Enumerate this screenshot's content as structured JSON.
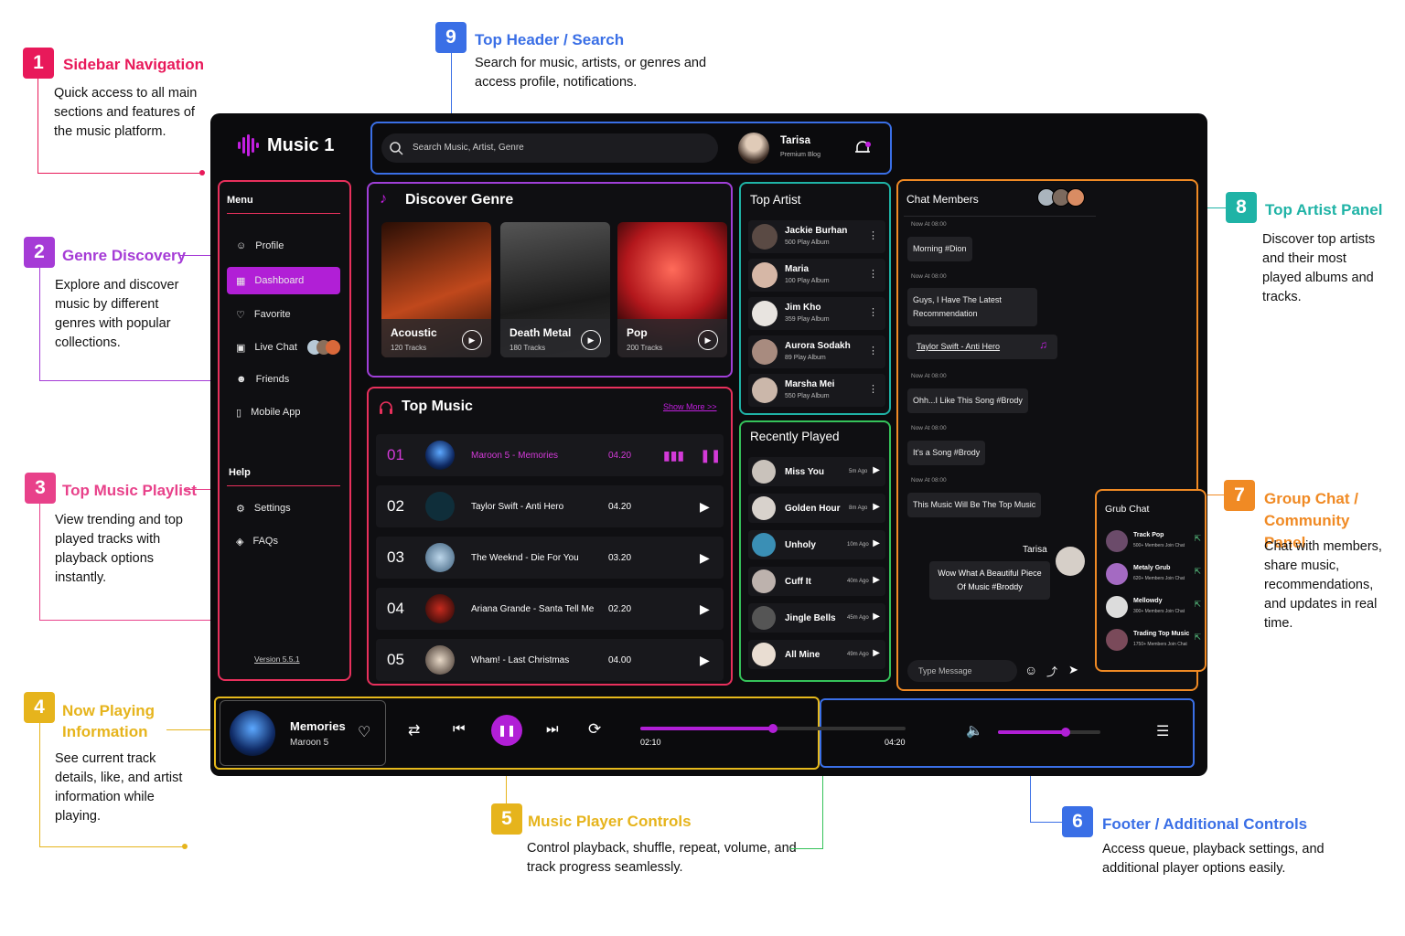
{
  "app": {
    "logo": "Music 1",
    "search_placeholder": "Search Music, Artist, Genre",
    "user_name": "Tarisa",
    "user_sub": "Premium Blog",
    "version": "Version 5.5.1"
  },
  "colors": {
    "accent": "#b11fd6",
    "sidebar_border": "#e8305c",
    "genre_border": "#a03fd8",
    "topmusic_border": "#e8305c",
    "topartist_border": "#1fb3a6",
    "recent_border": "#35c25a",
    "chat_border": "#f08a24",
    "header_border": "#3a6fe6",
    "player_border": "#e6b91c"
  },
  "sidebar": {
    "menu_label": "Menu",
    "items": [
      {
        "label": "Profile",
        "icon": "user-icon"
      },
      {
        "label": "Dashboard",
        "icon": "grid-icon",
        "active": true
      },
      {
        "label": "Favorite",
        "icon": "heart-icon"
      },
      {
        "label": "Live Chat",
        "icon": "chat-icon"
      },
      {
        "label": "Friends",
        "icon": "friends-icon"
      },
      {
        "label": "Mobile App",
        "icon": "phone-icon"
      }
    ],
    "help_label": "Help",
    "help_items": [
      {
        "label": "Settings",
        "icon": "gear-icon"
      },
      {
        "label": "FAQs",
        "icon": "help-icon"
      }
    ]
  },
  "genre": {
    "title": "Discover Genre",
    "items": [
      {
        "name": "Acoustic",
        "tracks": "120 Tracks"
      },
      {
        "name": "Death Metal",
        "tracks": "180 Tracks"
      },
      {
        "name": "Pop",
        "tracks": "200 Tracks"
      }
    ]
  },
  "top_music": {
    "title": "Top Music",
    "show_more": "Show More >>",
    "tracks": [
      {
        "num": "01",
        "name": "Maroon 5 - Memories",
        "time": "04.20"
      },
      {
        "num": "02",
        "name": "Taylor Swift - Anti Hero",
        "time": "04.20"
      },
      {
        "num": "03",
        "name": "The Weeknd - Die For You",
        "time": "03.20"
      },
      {
        "num": "04",
        "name": "Ariana Grande - Santa Tell Me",
        "time": "02.20"
      },
      {
        "num": "05",
        "name": "Wham! - Last Christmas",
        "time": "04.00"
      }
    ]
  },
  "top_artist": {
    "title": "Top Artist",
    "artists": [
      {
        "name": "Jackie Burhan",
        "albums": "500 Play Album"
      },
      {
        "name": "Maria",
        "albums": "100 Play Album"
      },
      {
        "name": "Jim Kho",
        "albums": "359 Play Album"
      },
      {
        "name": "Aurora Sodakh",
        "albums": "89 Play Album"
      },
      {
        "name": "Marsha Mei",
        "albums": "550 Play Album"
      }
    ]
  },
  "recent": {
    "title": "Recently Played",
    "items": [
      {
        "name": "Miss You",
        "ago": "5m Ago"
      },
      {
        "name": "Golden Hour",
        "ago": "8m Ago"
      },
      {
        "name": "Unholy",
        "ago": "10m Ago"
      },
      {
        "name": "Cuff It",
        "ago": "40m Ago"
      },
      {
        "name": "Jingle Bells",
        "ago": "45m Ago"
      },
      {
        "name": "All Mine",
        "ago": "49m Ago"
      }
    ]
  },
  "chat": {
    "title": "Chat Members",
    "stamp": "Now At 08:00",
    "messages": [
      "Morning #Dion",
      "Guys, I Have The Latest Recommendation",
      "Taylor Swift - Anti Hero",
      "Ohh...I Like This Song #Brody",
      "It's a Song #Brody",
      "This Music Will Be The Top Music"
    ],
    "reply_name": "Tarisa",
    "reply_text": "Wow What A Beautiful Piece Of Music #Broddy",
    "input_placeholder": "Type Message"
  },
  "group_chat": {
    "title": "Grub Chat",
    "groups": [
      {
        "name": "Track Pop",
        "members": "500+ Members Join Chat"
      },
      {
        "name": "Metaly Grub",
        "members": "620+ Members Join Chat"
      },
      {
        "name": "Mellowdy",
        "members": "300+ Members Join Chat"
      },
      {
        "name": "Trading Top Music",
        "members": "1750+ Members Join Chat"
      }
    ]
  },
  "player": {
    "title": "Memories",
    "artist": "Maroon 5",
    "elapsed": "02:10",
    "total": "04:20",
    "progress": 0.5,
    "volume": 0.66
  },
  "annotations": [
    {
      "num": "1",
      "title": "Sidebar Navigation",
      "desc": "Quick access to all main sections and features of the music platform.",
      "color": "#e8195a"
    },
    {
      "num": "2",
      "title": "Genre Discovery",
      "desc": "Explore and discover music by different genres with popular collections.",
      "color": "#a53bd6"
    },
    {
      "num": "3",
      "title": "Top Music Playlist",
      "desc": "View trending and top played tracks with playback options instantly.",
      "color": "#e8418a"
    },
    {
      "num": "4",
      "title": "Now Playing Information",
      "desc": "See current track details, like, and artist information while playing.",
      "color": "#e6b41c"
    },
    {
      "num": "5",
      "title": "Music Player Controls",
      "desc": "Control playback, shuffle, repeat, volume, and track progress seamlessly.",
      "color": "#e6b41c"
    },
    {
      "num": "6",
      "title": "Footer / Additional Controls",
      "desc": "Access queue, playback settings, and additional player options easily.",
      "color": "#3a6fe6"
    },
    {
      "num": "7",
      "title": "Group Chat / Community Panel",
      "desc": "Chat with members, share music, recommendations, and updates in real time.",
      "color": "#f08a24"
    },
    {
      "num": "8",
      "title": "Top Artist Panel",
      "desc": "Discover top artists and their most played albums and tracks.",
      "color": "#1fb3a6"
    },
    {
      "num": "9",
      "title": "Top Header / Search",
      "desc": "Search for music, artists, or genres and access profile, notifications.",
      "color": "#3a6fe6"
    }
  ]
}
